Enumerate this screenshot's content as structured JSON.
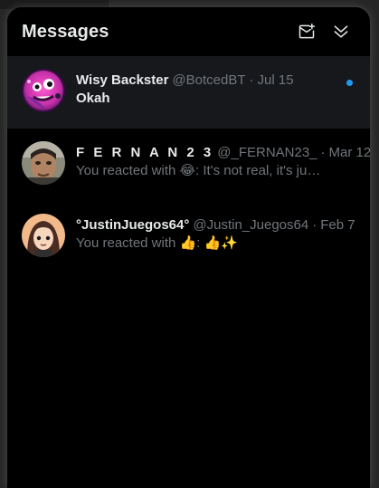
{
  "panel": {
    "title": "Messages",
    "new_message_icon": "envelope-plus-icon",
    "collapse_icon": "double-chevron-down-icon"
  },
  "conversations": [
    {
      "name": "Wisy Backster",
      "handle": "@BotcedBT",
      "separator": "·",
      "date": "Jul 15",
      "preview": "Okah",
      "unread": true,
      "avatar": "pink-creature-avatar"
    },
    {
      "name": "F E R N A N 2 3",
      "handle": "@_FERNAN23_",
      "separator": "·",
      "date": "Mar 12",
      "preview": "You reacted with 😂: It's not real, it's just an edit",
      "unread": false,
      "avatar": "man-face-avatar"
    },
    {
      "name": "°JustinJuegos64°",
      "handle": "@Justin_Juegos64",
      "separator": "·",
      "date": "Feb 7",
      "preview": "You reacted with 👍: 👍✨",
      "unread": false,
      "avatar": "anime-girl-avatar"
    }
  ],
  "colors": {
    "accent_blue": "#1d9bf0",
    "text_primary": "#e7e9ea",
    "text_secondary": "#71767b",
    "background": "#000000",
    "unread_row": "#16181c"
  }
}
